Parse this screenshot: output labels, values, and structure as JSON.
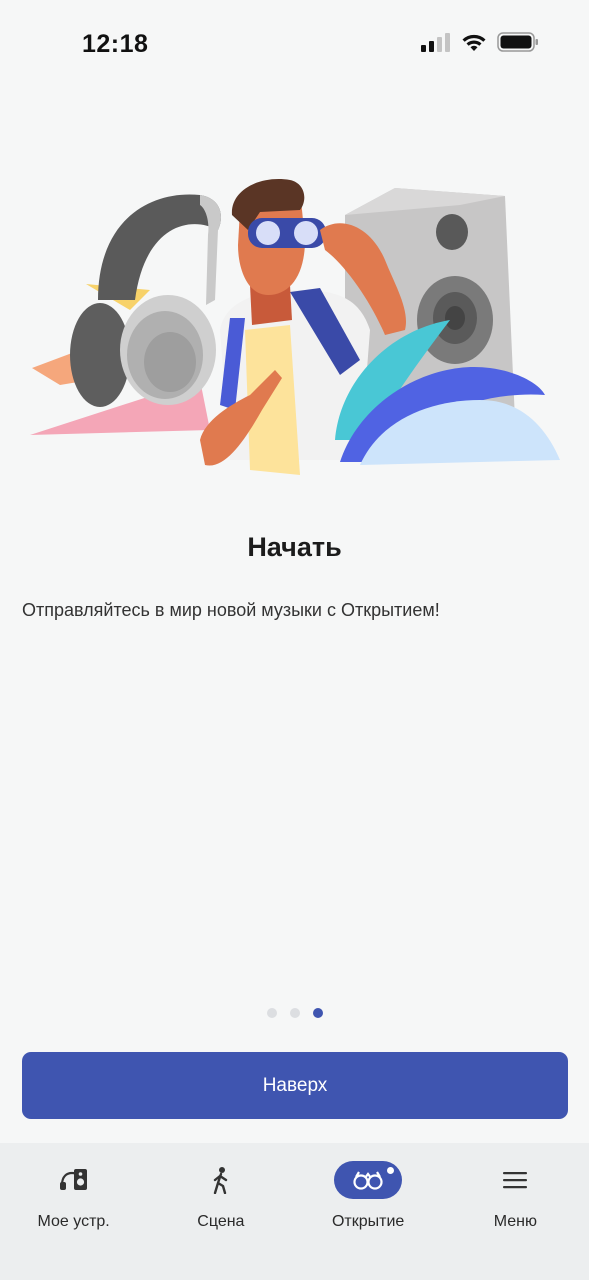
{
  "status_bar": {
    "time": "12:18"
  },
  "onboarding": {
    "title": "Начать",
    "description": "Отправляйтесь в мир новой музыки с Открытием!",
    "page_count": 3,
    "active_page": 3,
    "button_label": "Наверх"
  },
  "tabs": [
    {
      "label": "Мое устр.",
      "icon": "speaker-headphones-icon",
      "active": false
    },
    {
      "label": "Сцена",
      "icon": "walking-person-icon",
      "active": false
    },
    {
      "label": "Открытие",
      "icon": "binoculars-icon",
      "active": true
    },
    {
      "label": "Меню",
      "icon": "hamburger-menu-icon",
      "active": false
    }
  ],
  "colors": {
    "accent": "#3f55b0",
    "background": "#f6f7f7",
    "tab_bar": "#eceeef",
    "inactive_dot": "#dcdee1"
  }
}
